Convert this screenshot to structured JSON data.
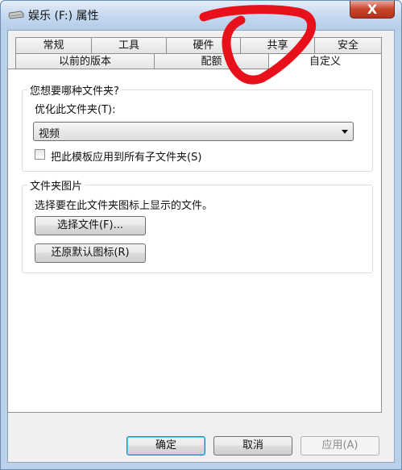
{
  "window": {
    "title": "娱乐 (F:) 属性",
    "close_label": "X"
  },
  "tabs": {
    "row1": [
      "常规",
      "工具",
      "硬件",
      "共享",
      "安全"
    ],
    "row2": [
      "以前的版本",
      "配额",
      "自定义"
    ]
  },
  "optimize_group": {
    "title": "您想要哪种文件夹?",
    "optimize_label": "优化此文件夹(T):",
    "selected_value": "视频",
    "apply_checkbox_label": "把此模板应用到所有子文件夹(S)",
    "apply_checked": false
  },
  "picture_group": {
    "title": "文件夹图片",
    "description": "选择要在此文件夹图标上显示的文件。",
    "choose_file_button": "选择文件(F)...",
    "restore_default_button": "还原默认图标(R)"
  },
  "footer": {
    "ok_button": "确定",
    "cancel_button": "取消",
    "apply_button": "应用(A)"
  },
  "colors": {
    "annotation_red": "#e8101a",
    "title_gradient_top": "#e4eef9",
    "close_button": "#c7452b"
  }
}
